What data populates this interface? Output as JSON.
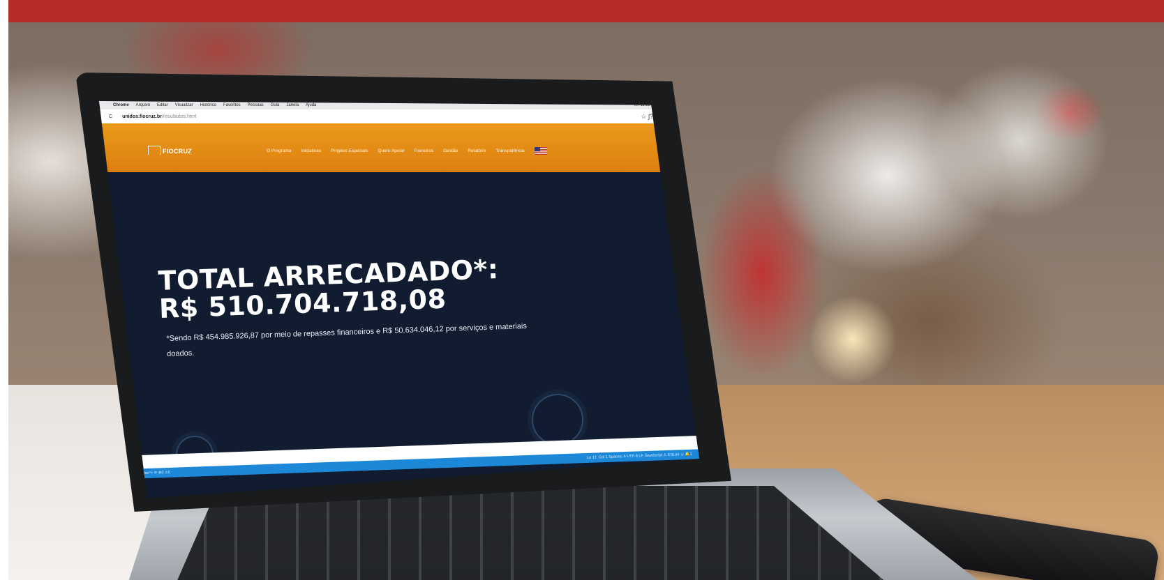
{
  "mac_menubar": {
    "items": [
      "Chrome",
      "Arquivo",
      "Editar",
      "Visualizar",
      "Histórico",
      "Favoritos",
      "Pessoas",
      "Guia",
      "Janela",
      "Ajuda"
    ],
    "clock": "Ter 11:25"
  },
  "browser": {
    "reload_icon": "C",
    "url_host": "unidos.fiocruz.br",
    "url_path": "/resultados.html",
    "right_icons": "☆  ʃ?"
  },
  "site": {
    "logo_text": "FIOCRUZ",
    "nav": [
      "O Programa",
      "Iniciativas",
      "Projetos Especiais",
      "Quero Apoiar",
      "Parceiros",
      "Gestão",
      "Relatório",
      "Transparência"
    ],
    "language_flag_icon": "us-flag-icon"
  },
  "hero": {
    "title_line1": "TOTAL ARRECADADO*:",
    "title_line2": "R$ 510.704.718,08",
    "note": "*Sendo R$ 454.985.926,87 por meio de repasses financeiros e R$ 50.634.046,12 por serviços e materiais doados."
  },
  "editor_status": {
    "left": "ᚠ master*+   ⟳  ⊗0 ⚠0",
    "right": "Ln 17, Col 1   Spaces: 4   UTF-8   LF   JavaScript   ⚠ ESLint   ☺  🔔1"
  },
  "colors": {
    "top_bar": "#b62b27",
    "site_header": "#e38a14",
    "hero_bg": "#111c30",
    "editor_status": "#1e88d8"
  }
}
